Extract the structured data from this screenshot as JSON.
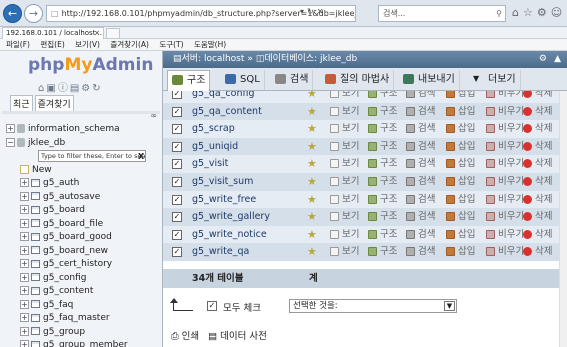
{
  "browser": {
    "url": "http://192.168.0.101/phpmyadmin/db_structure.php?server=1&db=jklee_db",
    "search_placeholder": "검색...",
    "tab_title": "192.168.0.101 / localhost ..."
  },
  "menubar": [
    "파일(F)",
    "편집(E)",
    "보기(V)",
    "즐겨찾기(A)",
    "도구(T)",
    "도움말(H)"
  ],
  "sidebar": {
    "logo": {
      "php": "php",
      "my": "My",
      "admin": "Admin"
    },
    "recent_label": "최근",
    "favorites_label": "즐겨찾기",
    "tree": {
      "info_schema": "information_schema",
      "current_db": "jklee_db",
      "filter_placeholder": "Type to filter these, Enter to search",
      "filter_clear": "X",
      "new_label": "New",
      "tables": [
        "g5_auth",
        "g5_autosave",
        "g5_board",
        "g5_board_file",
        "g5_board_good",
        "g5_board_new",
        "g5_cert_history",
        "g5_config",
        "g5_content",
        "g5_faq",
        "g5_faq_master",
        "g5_group",
        "g5_group_member"
      ]
    }
  },
  "serverbar": {
    "server": "서버: localhost",
    "database": "데이터베이스: jklee_db"
  },
  "tabs": [
    {
      "label": "구조",
      "color": "#6a8a3a"
    },
    {
      "label": "SQL",
      "color": "#3a6aa8"
    },
    {
      "label": "검색",
      "color": "#888888"
    },
    {
      "label": "질의 마법사",
      "color": "#c85a3a"
    },
    {
      "label": "내보내기",
      "color": "#3a7a5a"
    },
    {
      "label": "더보기",
      "color": "#444444"
    }
  ],
  "actions": {
    "browse": "보기",
    "structure": "구조",
    "search": "검색",
    "insert": "삽입",
    "empty": "비우기",
    "drop": "삭제"
  },
  "table_rows": [
    "g5_qa_config",
    "g5_qa_content",
    "g5_scrap",
    "g5_uniqid",
    "g5_visit",
    "g5_visit_sum",
    "g5_write_free",
    "g5_write_gallery",
    "g5_write_notice",
    "g5_write_qa"
  ],
  "summary": {
    "count": "34개 테이블",
    "total": "계"
  },
  "bulk": {
    "check_all": "모두 체크",
    "with_selected": "선택한 것을:"
  },
  "bottom_links": {
    "print": "인쇄",
    "dictionary": "데이터 사전"
  }
}
